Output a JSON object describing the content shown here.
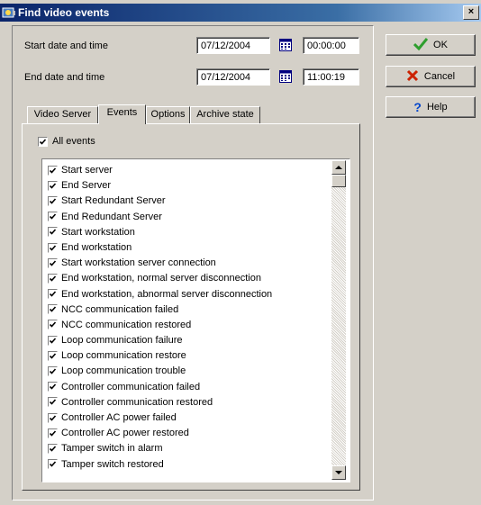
{
  "window": {
    "title": "Find video events",
    "close_label": "×"
  },
  "dates": {
    "start_label": "Start date and time",
    "start_date": "07/12/2004",
    "start_time": "00:00:00",
    "end_label": "End date and time",
    "end_date": "07/12/2004",
    "end_time": "11:00:19"
  },
  "buttons": {
    "ok": "OK",
    "cancel": "Cancel",
    "help": "Help"
  },
  "tabs": [
    "Video Server",
    "Events",
    "Options",
    "Archive state"
  ],
  "active_tab": "Events",
  "all_events": {
    "label": "All events",
    "checked": true
  },
  "events": [
    "Start server",
    "End Server",
    "Start Redundant Server",
    "End Redundant Server",
    "Start workstation",
    "End workstation",
    "Start workstation server connection",
    "End workstation, normal server disconnection",
    "End workstation, abnormal server disconnection",
    "NCC communication failed",
    "NCC communication restored",
    "Loop communication failure",
    "Loop communication restore",
    "Loop communication trouble",
    "Controller communication failed",
    "Controller communication restored",
    "Controller AC power failed",
    "Controller AC power restored",
    "Tamper switch in alarm",
    "Tamper switch restored"
  ],
  "colors": {
    "ok_icon": "#2e9e2e",
    "cancel_icon": "#cc2200",
    "help_icon": "#0044cc"
  }
}
